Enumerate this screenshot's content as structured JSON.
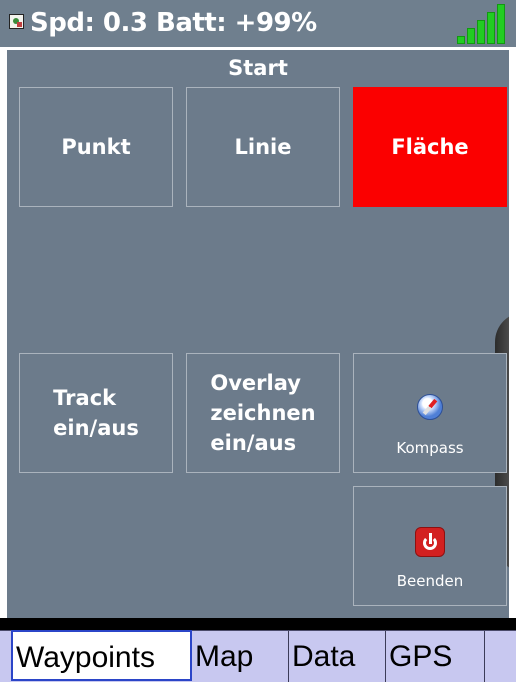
{
  "status_bar": {
    "app_icon": "map-app-icon",
    "text": "Spd: 0.3 Batt: +99%",
    "signal_icon": "signal-strength-icon",
    "signal_bars": 5
  },
  "panel": {
    "title": "Start",
    "tiles": {
      "punkt": "Punkt",
      "linie": "Linie",
      "flaeche": "Fläche",
      "track": "Track\nein/aus",
      "overlay": "Overlay\nzeichnen\nein/aus",
      "kompass": "Kompass",
      "beenden": "Beenden"
    },
    "active_tile": "flaeche",
    "icons": {
      "kompass": "compass-icon",
      "beenden": "power-icon"
    }
  },
  "tabs": [
    {
      "label": "Waypoints",
      "selected": true
    },
    {
      "label": "Map",
      "selected": false
    },
    {
      "label": "Data",
      "selected": false
    },
    {
      "label": "GPS",
      "selected": false
    },
    {
      "label": "",
      "selected": false
    }
  ],
  "colors": {
    "panel_background": "#6c7b8b",
    "active_tile": "#fb0000",
    "tab_background": "#c8c8f0",
    "tab_selected_border": "#2b45c8",
    "signal": "#22cc22"
  }
}
